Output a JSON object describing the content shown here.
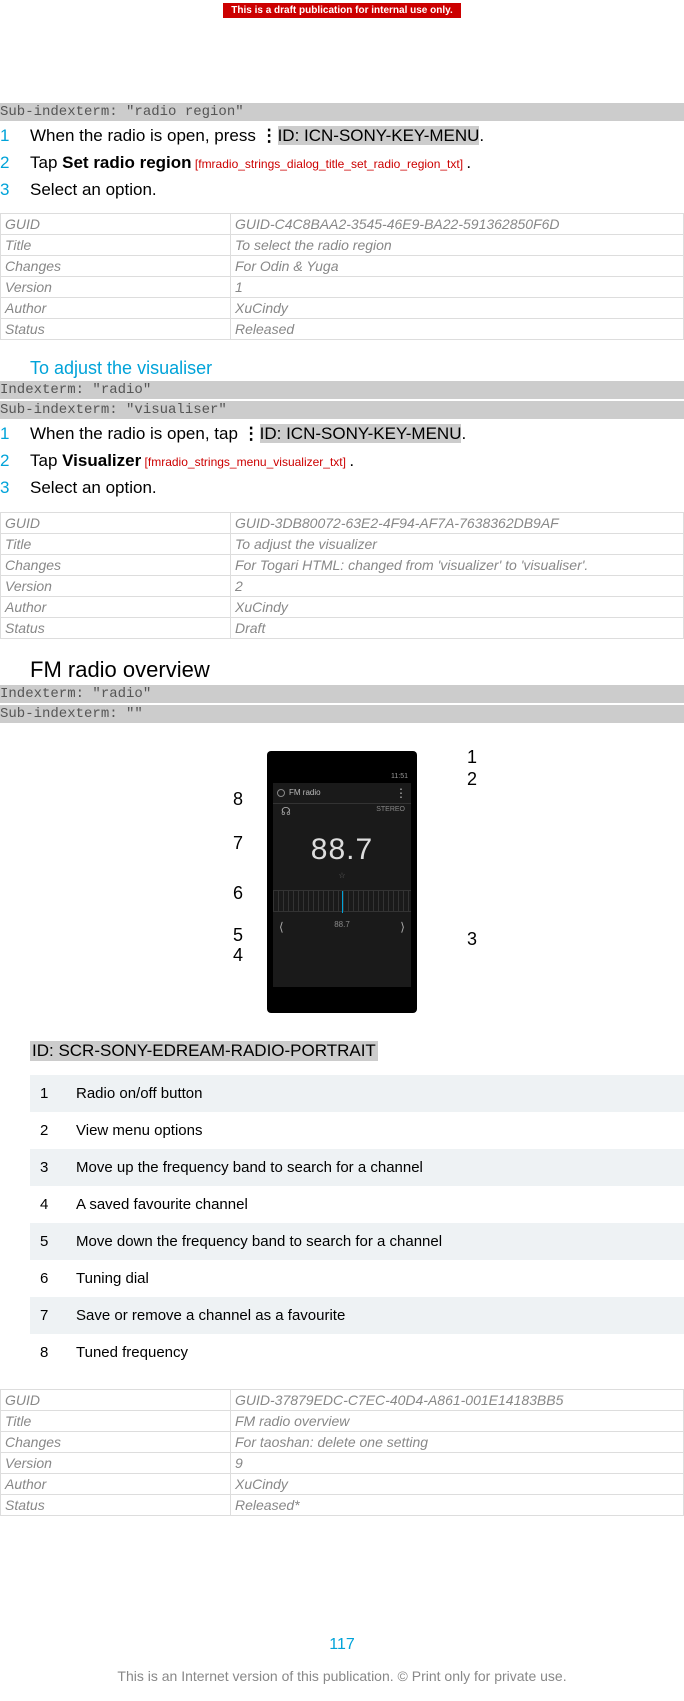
{
  "banner": "This is a draft publication for internal use only.",
  "block1": {
    "indexterm": "Sub-indexterm: \"radio region\"",
    "steps": [
      {
        "num": "1",
        "pre": "When the radio is open, press ",
        "id": "ID: ICN-SONY-KEY-MENU",
        "post": "."
      },
      {
        "num": "2",
        "pre": "Tap ",
        "bold": "Set radio region",
        "annot": " [fmradio_strings_dialog_title_set_radio_region_txt] ",
        "post": "."
      },
      {
        "num": "3",
        "pre": "Select an option.",
        "bold": "",
        "annot": "",
        "post": ""
      }
    ],
    "meta": {
      "GUID": "GUID-C4C8BAA2-3545-46E9-BA22-591362850F6D",
      "Title": "To select the radio region",
      "Changes": "For Odin & Yuga",
      "Version": "1",
      "Author": "XuCindy",
      "Status": "Released"
    }
  },
  "block2": {
    "heading": "To adjust the visualiser",
    "indexterm1": "Indexterm: \"radio\"",
    "indexterm2": "Sub-indexterm: \"visualiser\"",
    "steps": [
      {
        "num": "1",
        "pre": "When the radio is open, tap ",
        "id": "ID: ICN-SONY-KEY-MENU",
        "post": "."
      },
      {
        "num": "2",
        "pre": "Tap ",
        "bold": "Visualizer",
        "annot": " [fmradio_strings_menu_visualizer_txt] ",
        "post": "."
      },
      {
        "num": "3",
        "pre": "Select an option.",
        "bold": "",
        "annot": "",
        "post": ""
      }
    ],
    "meta": {
      "GUID": "GUID-3DB80072-63E2-4F94-AF7A-7638362DB9AF",
      "Title": "To adjust the visualizer",
      "Changes": "For Togari HTML: changed from 'visualizer' to 'visualiser'.",
      "Version": "2",
      "Author": "XuCindy",
      "Status": "Draft"
    }
  },
  "block3": {
    "heading": "FM radio overview",
    "indexterm1": "Indexterm: \"radio\"",
    "indexterm2": "Sub-indexterm: \"\"",
    "phone": {
      "time": "11:51",
      "title": "FM radio",
      "stereo": "STEREO",
      "freq": "88.7",
      "favlabel": "88.7"
    },
    "callouts": {
      "c1": "1",
      "c2": "2",
      "c3": "3",
      "c4": "4",
      "c5": "5",
      "c6": "6",
      "c7": "7",
      "c8": "8"
    },
    "idline": "ID: SCR-SONY-EDREAM-RADIO-PORTRAIT",
    "legend": [
      {
        "n": "1",
        "t": "Radio on/off button"
      },
      {
        "n": "2",
        "t": "View menu options"
      },
      {
        "n": "3",
        "t": "Move up the frequency band to search for a channel"
      },
      {
        "n": "4",
        "t": "A saved favourite channel"
      },
      {
        "n": "5",
        "t": "Move down the frequency band to search for a channel"
      },
      {
        "n": "6",
        "t": "Tuning dial"
      },
      {
        "n": "7",
        "t": "Save or remove a channel as a favourite"
      },
      {
        "n": "8",
        "t": "Tuned frequency"
      }
    ],
    "meta": {
      "GUID": "GUID-37879EDC-C7EC-40D4-A861-001E14183BB5",
      "Title": "FM radio overview",
      "Changes": "For taoshan: delete one setting",
      "Version": "9",
      "Author": "XuCindy",
      "Status": "Released*"
    }
  },
  "pagenum": "117",
  "footer": "This is an Internet version of this publication. © Print only for private use."
}
